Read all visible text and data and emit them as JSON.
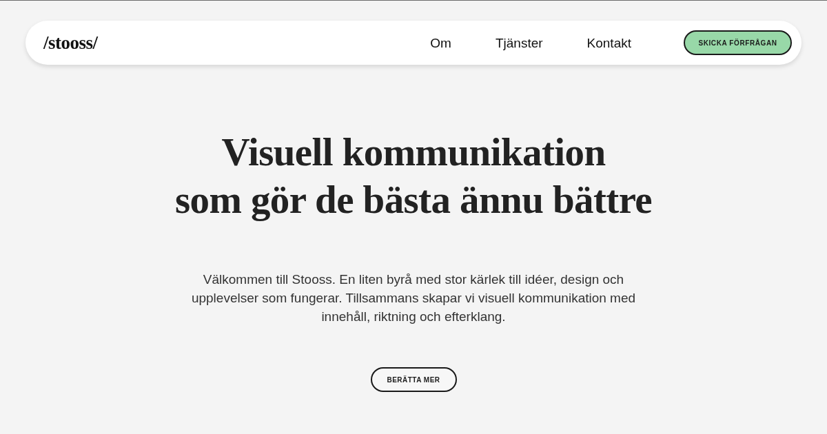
{
  "header": {
    "logo": "/stooss/",
    "links": [
      {
        "label": "Om"
      },
      {
        "label": "Tjänster"
      },
      {
        "label": "Kontakt"
      }
    ],
    "cta": "SKICKA FÖRFRÅGAN"
  },
  "hero": {
    "headline_lines": [
      "Visuell kommunikation",
      "som gör de bästa ännu bättre"
    ],
    "intro": "Välkommen till Stooss. En liten byrå med stor kärlek till idéer, design och upplevelser som fungerar. Tillsammans skapar vi visuell kommunikation med innehåll, riktning och efterklang.",
    "button": "BERÄTTA MER"
  }
}
